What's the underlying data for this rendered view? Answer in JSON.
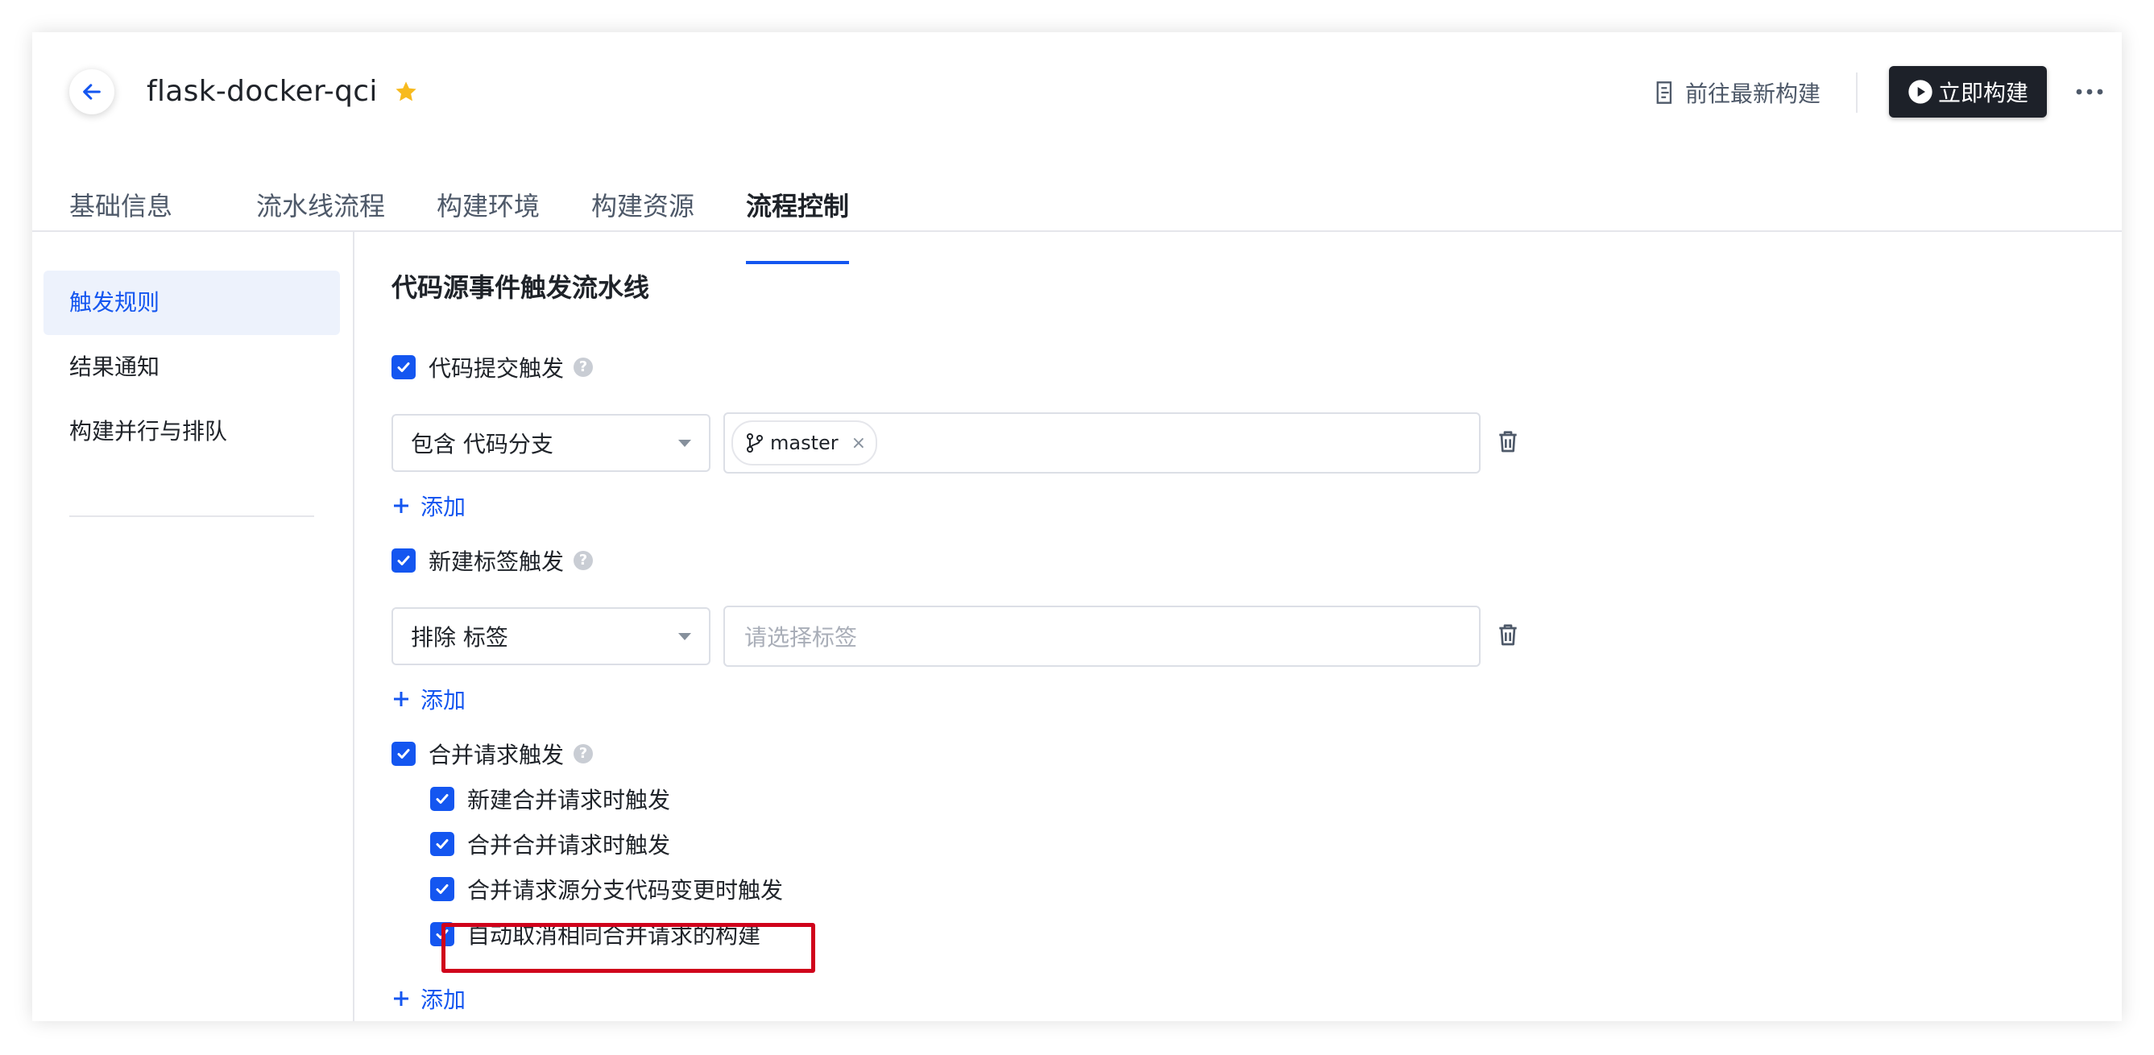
{
  "header": {
    "title": "flask-docker-qci",
    "goto_latest_label": "前往最新构建",
    "build_now_label": "立即构建"
  },
  "tabs": [
    {
      "label": "基础信息",
      "active": false
    },
    {
      "label": "流水线流程",
      "active": false
    },
    {
      "label": "构建环境",
      "active": false
    },
    {
      "label": "构建资源",
      "active": false
    },
    {
      "label": "流程控制",
      "active": true
    }
  ],
  "sidebar": {
    "items": [
      {
        "label": "触发规则",
        "active": true
      },
      {
        "label": "结果通知",
        "active": false
      },
      {
        "label": "构建并行与排队",
        "active": false
      }
    ]
  },
  "content": {
    "section_title": "代码源事件触发流水线",
    "push_trigger": {
      "label": "代码提交触发",
      "checked": true,
      "select_value": "包含 代码分支",
      "chip": "master",
      "add_label": "添加"
    },
    "tag_trigger": {
      "label": "新建标签触发",
      "checked": true,
      "select_value": "排除 标签",
      "placeholder": "请选择标签",
      "add_label": "添加"
    },
    "mr_trigger": {
      "label": "合并请求触发",
      "checked": true,
      "options": [
        {
          "label": "新建合并请求时触发",
          "checked": true
        },
        {
          "label": "合并合并请求时触发",
          "checked": true
        },
        {
          "label": "合并请求源分支代码变更时触发",
          "checked": true
        },
        {
          "label": "自动取消相同合并请求的构建",
          "checked": true
        }
      ],
      "add_label": "添加"
    }
  },
  "colors": {
    "accent": "#1456f0",
    "dark_button": "#1d2129",
    "star": "#f7ba1e",
    "highlight": "#d0021b"
  },
  "icons": {
    "back": "arrow-left-icon",
    "star": "star-icon",
    "goto_latest": "document-icon",
    "build": "play-circle-icon",
    "more": "ellipsis-icon",
    "help": "question-icon",
    "branch": "git-branch-icon",
    "delete": "trash-icon",
    "add": "plus-icon"
  }
}
